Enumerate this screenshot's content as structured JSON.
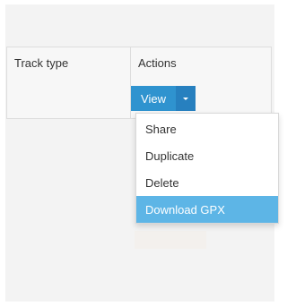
{
  "table": {
    "headers": [
      "Track type",
      "Actions"
    ]
  },
  "actions": {
    "view_label": "View",
    "dropdown_items": [
      "Share",
      "Duplicate",
      "Delete",
      "Download GPX"
    ],
    "active_item": "Download GPX"
  },
  "colors": {
    "primary": "#2f93cf",
    "primary_dark": "#2780bf",
    "highlight": "#5db5e6"
  }
}
